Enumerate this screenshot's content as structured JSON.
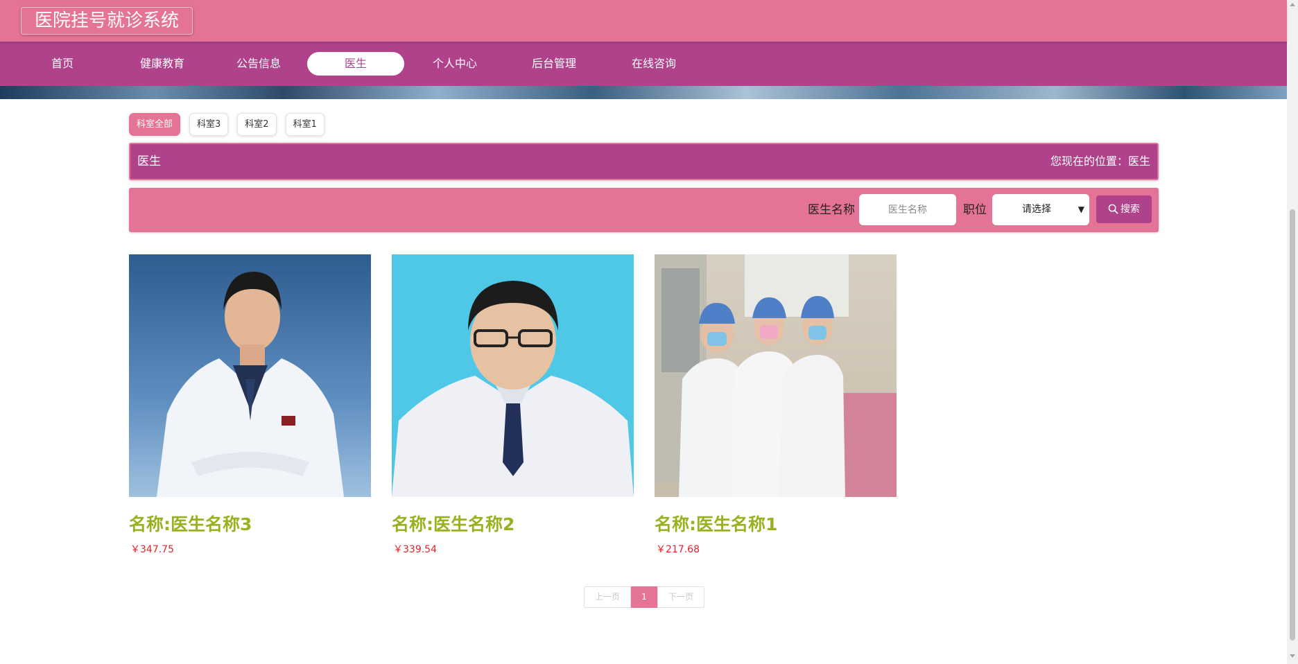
{
  "header": {
    "title": "医院挂号就诊系统"
  },
  "nav": {
    "items": [
      {
        "label": "首页"
      },
      {
        "label": "健康教育"
      },
      {
        "label": "公告信息"
      },
      {
        "label": "医生",
        "active": true
      },
      {
        "label": "个人中心"
      },
      {
        "label": "后台管理"
      },
      {
        "label": "在线咨询"
      }
    ]
  },
  "categories": [
    {
      "label": "科室全部",
      "active": true
    },
    {
      "label": "科室3"
    },
    {
      "label": "科室2"
    },
    {
      "label": "科室1"
    }
  ],
  "titlebar": {
    "title": "医生",
    "location": "您现在的位置：医生"
  },
  "search": {
    "name_label": "医生名称",
    "name_placeholder": "医生名称",
    "position_label": "职位",
    "position_selected": "请选择",
    "button_label": "搜索"
  },
  "doctors": [
    {
      "name": "名称:医生名称3",
      "price": "￥347.75",
      "photo": "doctor-portrait-1"
    },
    {
      "name": "名称:医生名称2",
      "price": "￥339.54",
      "photo": "doctor-portrait-2"
    },
    {
      "name": "名称:医生名称1",
      "price": "￥217.68",
      "photo": "doctor-group-photo"
    }
  ],
  "pagination": {
    "prev": "上一页",
    "current": "1",
    "next": "下一页"
  },
  "colors": {
    "header": "#e57395",
    "nav": "#b0428c",
    "title_text": "#9bb01f",
    "price": "#e0242a"
  }
}
